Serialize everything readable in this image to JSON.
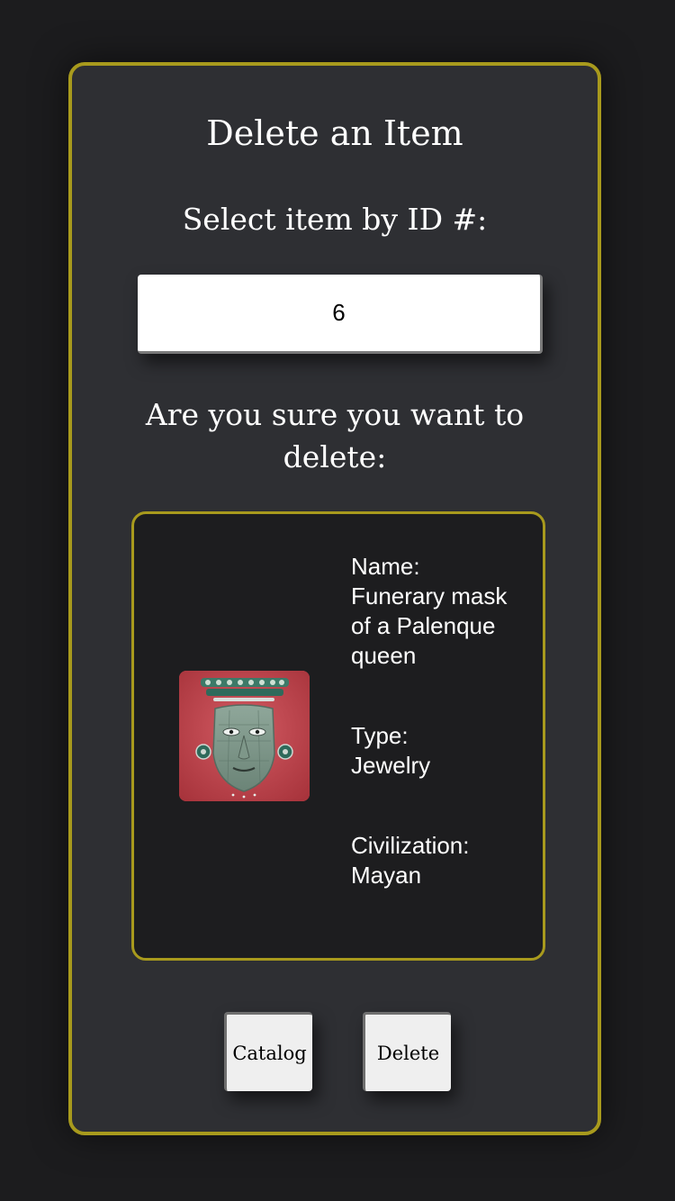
{
  "page": {
    "title": "Delete an Item",
    "select_label": "Select item by ID #:",
    "confirm_text": "Are you sure you want to delete:"
  },
  "id_input": {
    "value": "6"
  },
  "item": {
    "image_icon": "funerary-mask-image",
    "name_label": "Name:",
    "name_value": "Funerary mask of a Palenque queen",
    "type_label": "Type:",
    "type_value": "Jewelry",
    "civilization_label": "Civilization:",
    "civilization_value": "Mayan"
  },
  "buttons": {
    "catalog_label": "Catalog",
    "delete_label": "Delete"
  },
  "colors": {
    "background": "#1c1c1e",
    "panel": "#2e2f33",
    "accent_border": "#a89a1d",
    "card": "#1d1d1f",
    "text": "#ffffff",
    "button": "#efefef"
  }
}
